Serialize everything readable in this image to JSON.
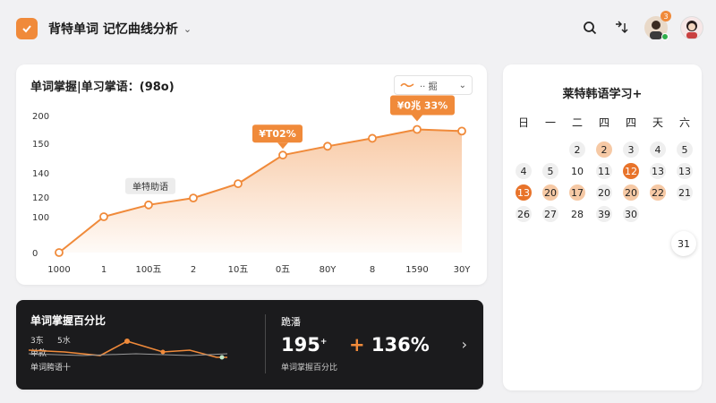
{
  "app": {
    "title": "背特单词 记忆曲线分析",
    "accent": "#f08a3a"
  },
  "topbar": {
    "search_icon": "search-icon",
    "tool_icon": "tool-icon",
    "notification_count": "3"
  },
  "main_card": {
    "title": "单词掌握|单习掌语：(98o)",
    "legend_label": "·· 掘"
  },
  "chart_data": {
    "type": "area",
    "title": "单词掌握|单习掌语：(98o)",
    "x": [
      "1000",
      "1",
      "100五",
      "2",
      "10五",
      "0五",
      "80Y",
      "8",
      "1590",
      "30Y"
    ],
    "y_ticks": [
      "0",
      "100",
      "120",
      "140",
      "150",
      "200"
    ],
    "values": [
      0,
      100,
      112,
      119,
      131,
      146,
      149,
      159,
      175,
      172
    ],
    "ylim": [
      0,
      200
    ],
    "series": [
      {
        "values": [
          0,
          100,
          112,
          119,
          131,
          146,
          149,
          159,
          175,
          172
        ]
      }
    ],
    "annotations": [
      {
        "label": "单特助语",
        "style": "gray"
      },
      {
        "label": "¥T02%",
        "style": "orange"
      },
      {
        "label": "¥0兆 33%",
        "style": "orange"
      }
    ],
    "grid": true,
    "legend": "top-right"
  },
  "dark_card": {
    "title": "单词掌握百分比",
    "mini_labels": [
      "3东",
      "5水",
      "单款",
      "单词胯语十"
    ],
    "right_title": "跪潘",
    "big_number": "195",
    "big_number_suffix": "+",
    "pct_plus": "+",
    "pct_value": "136%",
    "sub": "单词掌握百分比"
  },
  "calendar": {
    "title": "莱特韩语学习+",
    "weekdays": [
      "日",
      "一",
      "二",
      "四",
      "四",
      "天",
      "六"
    ],
    "weeks": [
      [
        {
          "n": "",
          "lv": 0
        },
        {
          "n": "",
          "lv": 0
        },
        {
          "n": "2",
          "lv": 1
        },
        {
          "n": "2",
          "lv": 2
        },
        {
          "n": "3",
          "lv": 1
        },
        {
          "n": "4",
          "lv": 1
        },
        {
          "n": "5",
          "lv": 1
        }
      ],
      [
        {
          "n": "4",
          "lv": 1
        },
        {
          "n": "5",
          "lv": 1
        },
        {
          "n": "10",
          "lv": 0
        },
        {
          "n": "11",
          "lv": 1
        },
        {
          "n": "12",
          "lv": 4
        },
        {
          "n": "13",
          "lv": 1
        },
        {
          "n": "13",
          "lv": 1
        }
      ],
      [
        {
          "n": "13",
          "lv": 4
        },
        {
          "n": "20",
          "lv": 2
        },
        {
          "n": "17",
          "lv": 2
        },
        {
          "n": "20",
          "lv": 1
        },
        {
          "n": "20",
          "lv": 2
        },
        {
          "n": "22",
          "lv": 2
        },
        {
          "n": "21",
          "lv": 1
        }
      ],
      [
        {
          "n": "26",
          "lv": 1
        },
        {
          "n": "27",
          "lv": 1
        },
        {
          "n": "28",
          "lv": 0
        },
        {
          "n": "39",
          "lv": 1
        },
        {
          "n": "30",
          "lv": 1
        },
        {
          "n": "",
          "lv": 0
        },
        {
          "n": "",
          "lv": 0
        }
      ]
    ],
    "last_day": "31"
  }
}
